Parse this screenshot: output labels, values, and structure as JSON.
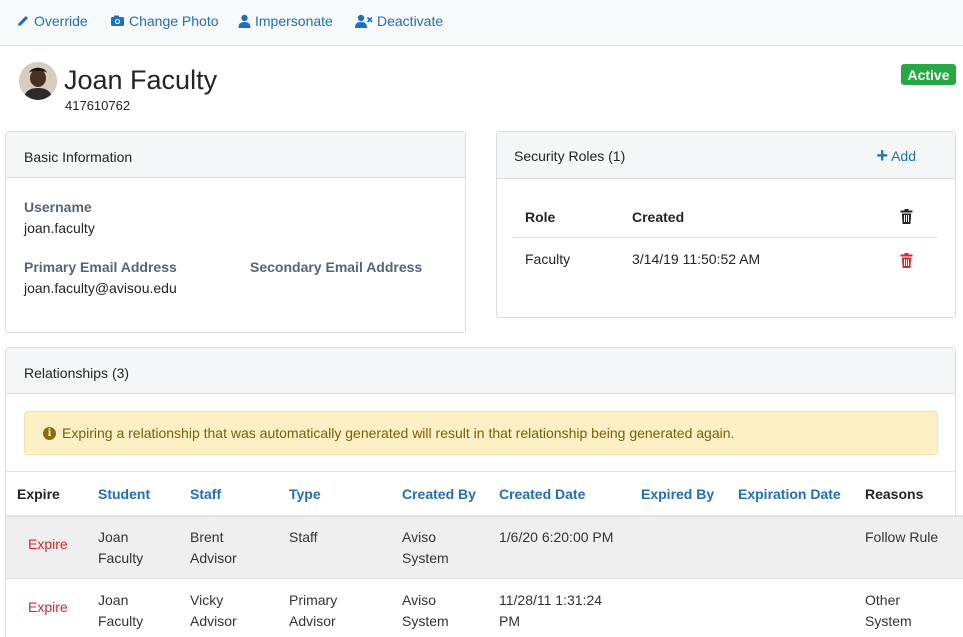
{
  "toolbar": {
    "override": "Override",
    "change_photo": "Change Photo",
    "impersonate": "Impersonate",
    "deactivate": "Deactivate"
  },
  "user": {
    "name": "Joan Faculty",
    "id": "417610762",
    "status": "Active"
  },
  "basic_info": {
    "title": "Basic Information",
    "username_label": "Username",
    "username": "joan.faculty",
    "primary_email_label": "Primary Email Address",
    "primary_email": "joan.faculty@avisou.edu",
    "secondary_email_label": "Secondary Email Address"
  },
  "security_roles": {
    "title": "Security Roles (1)",
    "add_label": "Add",
    "col_role": "Role",
    "col_created": "Created",
    "rows": [
      {
        "role": "Faculty",
        "created": "3/14/19 11:50:52 AM"
      }
    ]
  },
  "relationships": {
    "title": "Relationships (3)",
    "alert": "Expiring a relationship that was automatically generated will result in that relationship being generated again.",
    "columns": [
      "Expire",
      "Student",
      "Staff",
      "Type",
      "Created By",
      "Created Date",
      "Expired By",
      "Expiration Date",
      "Reasons"
    ],
    "rows": [
      {
        "expire": "Expire",
        "student": [
          "Joan",
          "Faculty"
        ],
        "staff": [
          "Brent",
          "Advisor"
        ],
        "type": [
          "Staff"
        ],
        "created_by": [
          "Aviso",
          "System"
        ],
        "created_date": [
          "1/6/20 6:20:00 PM"
        ],
        "expired_by": "",
        "expiration_date": "",
        "reasons": [
          "Follow Rule"
        ]
      },
      {
        "expire": "Expire",
        "student": [
          "Joan",
          "Faculty"
        ],
        "staff": [
          "Vicky",
          "Advisor"
        ],
        "type": [
          "Primary",
          "Advisor"
        ],
        "created_by": [
          "Aviso",
          "System"
        ],
        "created_date": [
          "11/28/11 1:31:24",
          "PM"
        ],
        "expired_by": "",
        "expiration_date": "",
        "reasons": [
          "Other",
          "System"
        ]
      }
    ]
  },
  "colors": {
    "link": "#1f6fbf",
    "active_badge": "#28a745",
    "danger": "#d9262b",
    "alert_bg": "#fdf0c4"
  }
}
